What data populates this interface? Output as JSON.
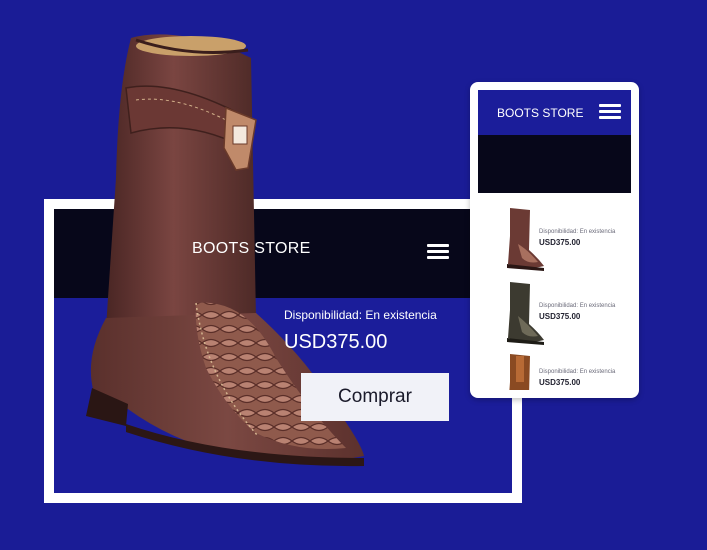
{
  "desktop": {
    "store_title": "BOOTS STORE",
    "availability": "Disponibilidad: En existencia",
    "price": "USD375.00",
    "buy_label": "Comprar"
  },
  "mobile": {
    "store_title": "BOOTS STORE",
    "products": [
      {
        "availability": "Disponibilidad:   En existencia",
        "price": "USD375.00",
        "color": "#6b3a34"
      },
      {
        "availability": "Disponibilidad:   En existencia",
        "price": "USD375.00",
        "color": "#3c3a30"
      },
      {
        "availability": "Disponibilidad:   En existencia",
        "price": "USD375.00",
        "color": "#8a4a22"
      }
    ]
  },
  "colors": {
    "background": "#1a1c96",
    "header_dark": "#07071a",
    "boot_leather": "#6e3a36",
    "boot_scales": "#a8705f"
  },
  "icons": [
    "hamburger-menu-icon",
    "hamburger-menu-icon"
  ]
}
